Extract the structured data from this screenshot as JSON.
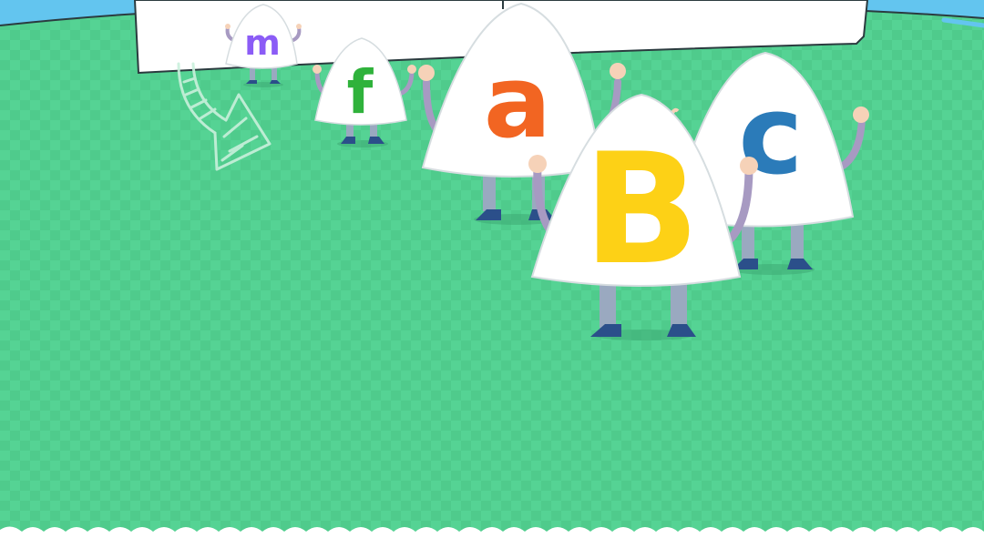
{
  "scene": {
    "ground_color": "#55d394",
    "checker_color": "#4fcb8c",
    "sky_color": "#63c5ef",
    "sign_color": "#ffffff",
    "bottom_border_color": "#ffffff"
  },
  "characters": [
    {
      "id": "m",
      "letter": "m",
      "color": "#8b5cf6"
    },
    {
      "id": "f",
      "letter": "f",
      "color": "#2fb23b"
    },
    {
      "id": "a",
      "letter": "a",
      "color": "#f26522"
    },
    {
      "id": "c",
      "letter": "c",
      "color": "#2b7bb9"
    },
    {
      "id": "b",
      "letter": "B",
      "color": "#fdd116"
    }
  ],
  "icons": {
    "arrow": "curved-arrow-icon"
  }
}
